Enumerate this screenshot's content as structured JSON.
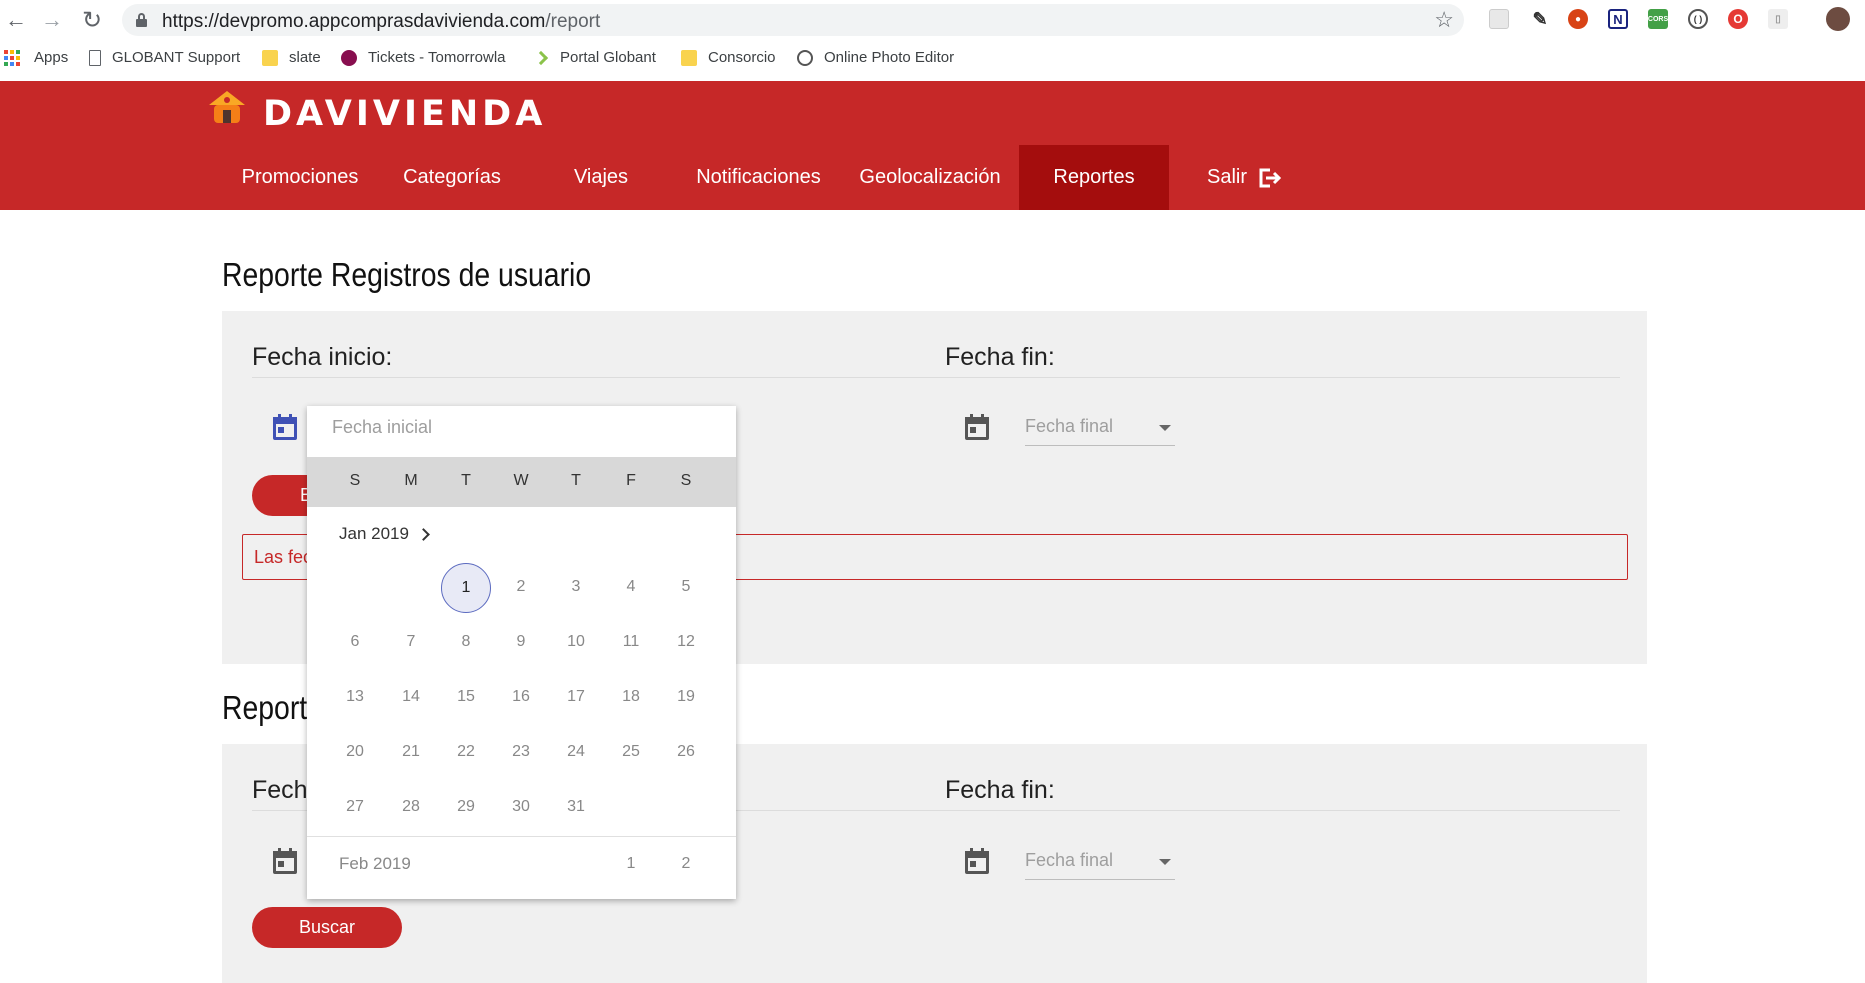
{
  "browser": {
    "url_host": "https://devpromo.appcomprasdavivienda.com",
    "url_path": "/report",
    "bookmarks": [
      "Apps",
      "GLOBANT Support",
      "slate",
      "Tickets - Tomorrowla",
      "Portal Globant",
      "Consorcio",
      "Online Photo Editor"
    ]
  },
  "site": {
    "logo_text": "DAVIVIENDA",
    "menu": [
      "Promociones",
      "Categorías",
      "Viajes",
      "Notificaciones",
      "Geolocalización",
      "Reportes",
      "Salir"
    ],
    "active_menu": "Reportes",
    "brand_color": "#c62828",
    "active_color": "#a40d0d"
  },
  "section1": {
    "title": "Reporte Registros de usuario",
    "start_label": "Fecha inicio:",
    "end_label": "Fecha fin:",
    "end_placeholder": "Fecha final",
    "button_visible": "B",
    "alert_visible": "Las fec"
  },
  "section2": {
    "title_visible": "Reporte",
    "start_label_visible": "Fech",
    "end_label": "Fecha fin:",
    "end_placeholder": "Fecha final",
    "button": "Buscar"
  },
  "datepicker": {
    "placeholder": "Fecha inicial",
    "weekdays": [
      "S",
      "M",
      "T",
      "W",
      "T",
      "F",
      "S"
    ],
    "month": "Jan 2019",
    "selected_day": "1",
    "weeks": [
      [
        "",
        "",
        "1",
        "2",
        "3",
        "4",
        "5"
      ],
      [
        "6",
        "7",
        "8",
        "9",
        "10",
        "11",
        "12"
      ],
      [
        "13",
        "14",
        "15",
        "16",
        "17",
        "18",
        "19"
      ],
      [
        "20",
        "21",
        "22",
        "23",
        "24",
        "25",
        "26"
      ],
      [
        "27",
        "28",
        "29",
        "30",
        "31",
        "",
        ""
      ]
    ],
    "next_month": "Feb 2019",
    "next_month_days": [
      "1",
      "2"
    ]
  }
}
